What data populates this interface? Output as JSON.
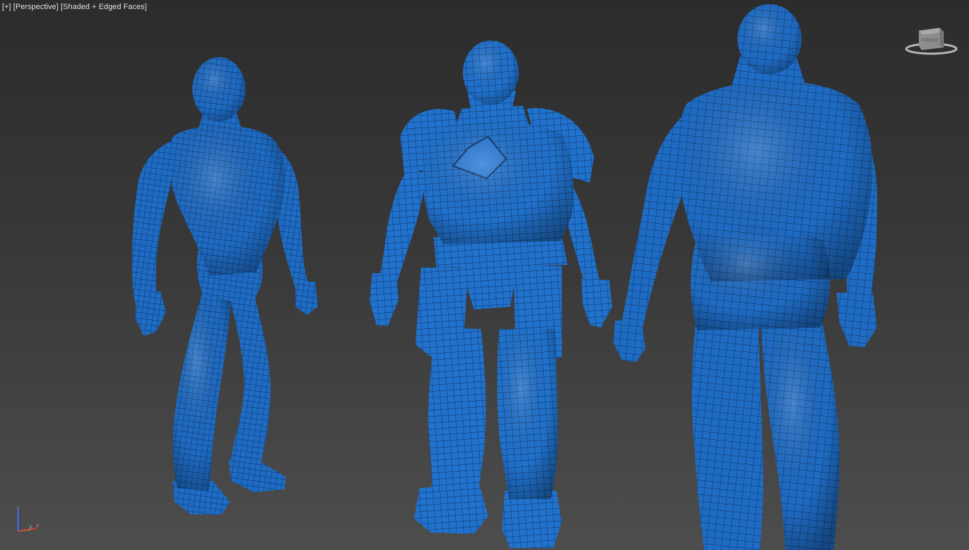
{
  "viewport": {
    "menu_label": "[+]",
    "view_label": "[Perspective]",
    "shading_label": "[Shaded + Edged Faces]"
  },
  "viewcube": {
    "face_label": "FRONT",
    "icon": "viewcube-icon"
  },
  "axis_tripod": {
    "icon": "axis-tripod-icon",
    "axes": [
      "z",
      "y",
      "x"
    ]
  },
  "models": [
    {
      "name": "muscular-figure-front",
      "icon": "wireframe-mesh"
    },
    {
      "name": "armored-figure-front",
      "icon": "wireframe-mesh"
    },
    {
      "name": "muscular-figure-back",
      "icon": "wireframe-mesh"
    }
  ],
  "colors": {
    "mesh_fill": "#1f6cc4",
    "mesh_edges": "#0b2f62",
    "background_top": "#2c2c2c",
    "background_bottom": "#4d4d4d",
    "axis_x": "#d93a3a",
    "axis_y": "#3fbf3f",
    "axis_z": "#3d6dff"
  }
}
